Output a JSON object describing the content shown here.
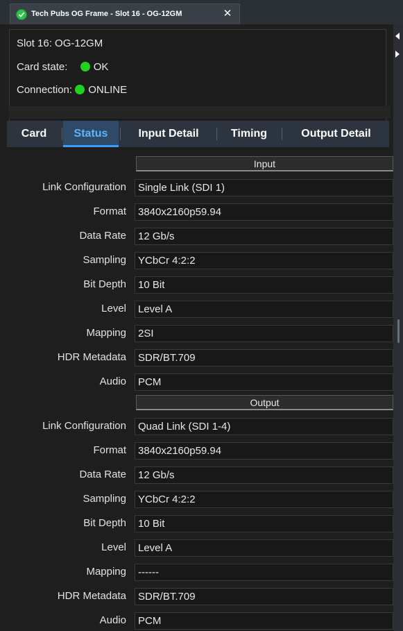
{
  "window": {
    "tab_title": "Tech Pubs OG Frame - Slot 16 - OG-12GM",
    "close_glyph": "✕"
  },
  "info": {
    "slot": "Slot 16: OG-12GM",
    "card_state_label": "Card state:",
    "card_state_value": "OK",
    "connection_label": "Connection:",
    "connection_value": "ONLINE",
    "status_color": "#1fd21f"
  },
  "tabs": [
    {
      "label": "Card"
    },
    {
      "label": "Status",
      "active": true
    },
    {
      "label": "Input Detail"
    },
    {
      "label": "Timing"
    },
    {
      "label": "Output Detail"
    }
  ],
  "input": {
    "header": "Input",
    "rows": [
      {
        "label": "Link Configuration",
        "value": "Single Link (SDI 1)"
      },
      {
        "label": "Format",
        "value": "3840x2160p59.94"
      },
      {
        "label": "Data Rate",
        "value": "12 Gb/s"
      },
      {
        "label": "Sampling",
        "value": "YCbCr 4:2:2"
      },
      {
        "label": "Bit Depth",
        "value": "10 Bit"
      },
      {
        "label": "Level",
        "value": "Level A"
      },
      {
        "label": "Mapping",
        "value": "2SI"
      },
      {
        "label": "HDR Metadata",
        "value": "SDR/BT.709"
      },
      {
        "label": "Audio",
        "value": "PCM"
      }
    ]
  },
  "output": {
    "header": "Output",
    "rows": [
      {
        "label": "Link Configuration",
        "value": "Quad Link (SDI 1-4)"
      },
      {
        "label": "Format",
        "value": "3840x2160p59.94"
      },
      {
        "label": "Data Rate",
        "value": "12 Gb/s"
      },
      {
        "label": "Sampling",
        "value": "YCbCr 4:2:2"
      },
      {
        "label": "Bit Depth",
        "value": "10 Bit"
      },
      {
        "label": "Level",
        "value": "Level A"
      },
      {
        "label": "Mapping",
        "value": "------"
      },
      {
        "label": "HDR Metadata",
        "value": "SDR/BT.709"
      },
      {
        "label": "Audio",
        "value": "PCM"
      }
    ]
  }
}
